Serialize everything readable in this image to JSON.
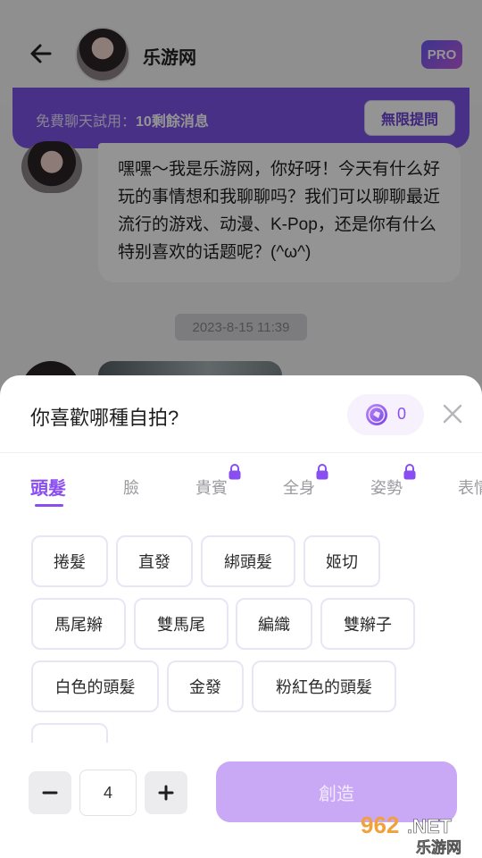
{
  "header": {
    "contact_name": "乐游网",
    "pro_badge": "PRO"
  },
  "trial_banner": {
    "text_prefix": "免費聊天試用：",
    "text_count": "10剩餘消息",
    "button": "無限提問"
  },
  "chat": {
    "message": "嘿嘿～我是乐游网，你好呀！今天有什么好玩的事情想和我聊聊吗？我们可以聊聊最近流行的游戏、动漫、K-Pop，还是你有什么特别喜欢的话题呢？(^ω^)",
    "timestamp": "2023-8-15 11:39"
  },
  "sheet": {
    "title": "你喜歡哪種自拍?",
    "coins": "0",
    "tabs": [
      {
        "label": "頭髮",
        "active": true,
        "locked": false
      },
      {
        "label": "臉",
        "active": false,
        "locked": false
      },
      {
        "label": "貴賓",
        "active": false,
        "locked": true
      },
      {
        "label": "全身",
        "active": false,
        "locked": true
      },
      {
        "label": "姿勢",
        "active": false,
        "locked": true
      },
      {
        "label": "表情",
        "active": false,
        "locked": false
      }
    ],
    "options": [
      "捲髮",
      "直發",
      "綁頭髮",
      "姬切",
      "馬尾辮",
      "雙馬尾",
      "編織",
      "雙辮子",
      "白色的頭髮",
      "金發",
      "粉紅色的頭髮",
      ""
    ],
    "quantity": "4",
    "create_button": "創造"
  },
  "watermark": {
    "number": "962",
    "suffix": ".NET",
    "site": "乐游网"
  },
  "colors": {
    "accent": "#8a4ef0",
    "banner": "#7b54e6",
    "create_disabled": "#c9a8f6"
  },
  "icons": [
    "back-arrow-icon",
    "pro-badge-icon",
    "coin-icon",
    "close-icon",
    "lock-icon",
    "minus-icon",
    "plus-icon"
  ]
}
